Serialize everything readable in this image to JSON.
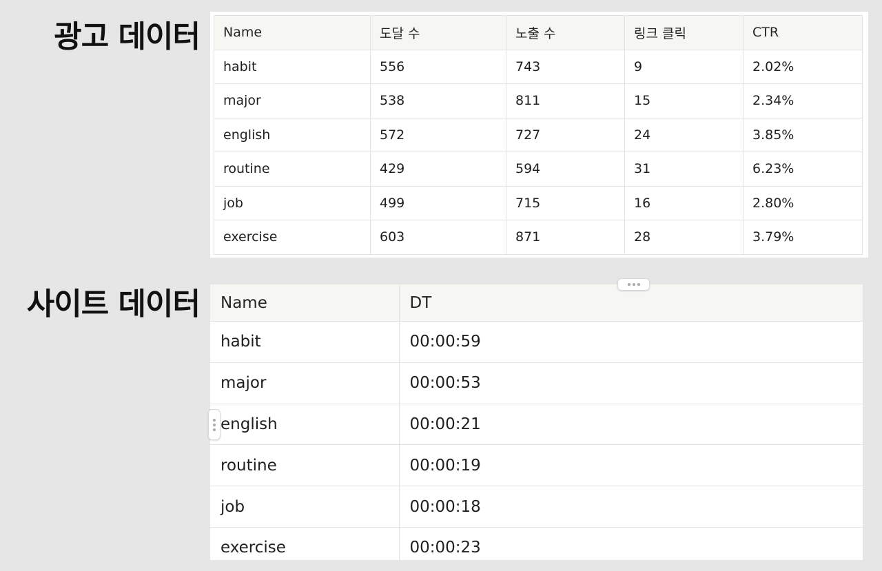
{
  "ad_section": {
    "title": "광고 데이터",
    "columns": [
      "Name",
      "도달 수",
      "노출 수",
      "링크 클릭",
      "CTR"
    ],
    "rows": [
      [
        "habit",
        "556",
        "743",
        "9",
        "2.02%"
      ],
      [
        "major",
        "538",
        "811",
        "15",
        "2.34%"
      ],
      [
        "english",
        "572",
        "727",
        "24",
        "3.85%"
      ],
      [
        "routine",
        "429",
        "594",
        "31",
        "6.23%"
      ],
      [
        "job",
        "499",
        "715",
        "16",
        "2.80%"
      ],
      [
        "exercise",
        "603",
        "871",
        "28",
        "3.79%"
      ]
    ]
  },
  "site_section": {
    "title": "사이트 데이터",
    "columns": [
      "Name",
      "DT"
    ],
    "rows": [
      [
        "habit",
        "00:00:59"
      ],
      [
        "major",
        "00:00:53"
      ],
      [
        "english",
        "00:00:21"
      ],
      [
        "routine",
        "00:00:19"
      ],
      [
        "job",
        "00:00:18"
      ],
      [
        "exercise",
        "00:00:23"
      ]
    ]
  },
  "icons": {
    "column_handle": "horizontal-dots-icon",
    "row_handle": "vertical-dots-icon"
  }
}
